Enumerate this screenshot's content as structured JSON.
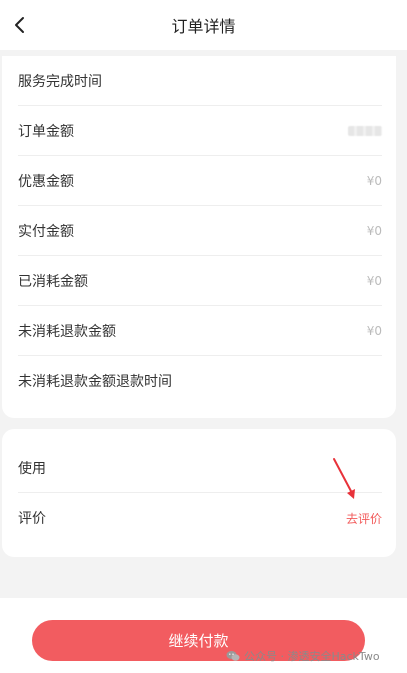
{
  "header": {
    "title": "订单详情"
  },
  "details": [
    {
      "label": "服务完成时间",
      "value": ""
    },
    {
      "label": "订单金额",
      "value": ""
    },
    {
      "label": "优惠金额",
      "value": "¥0"
    },
    {
      "label": "实付金额",
      "value": "¥0"
    },
    {
      "label": "已消耗金额",
      "value": "¥0"
    },
    {
      "label": "未消耗退款金额",
      "value": "¥0"
    },
    {
      "label": "未消耗退款金额退款时间",
      "value": ""
    }
  ],
  "actions": {
    "usage_label": "使用",
    "review_label": "评价",
    "review_link": "去评价"
  },
  "footer": {
    "pay_button": "继续付款",
    "watermark": "公众号 · 渗透安全HackTwo"
  },
  "colors": {
    "accent": "#f25c60",
    "background": "#f3f3f3"
  }
}
